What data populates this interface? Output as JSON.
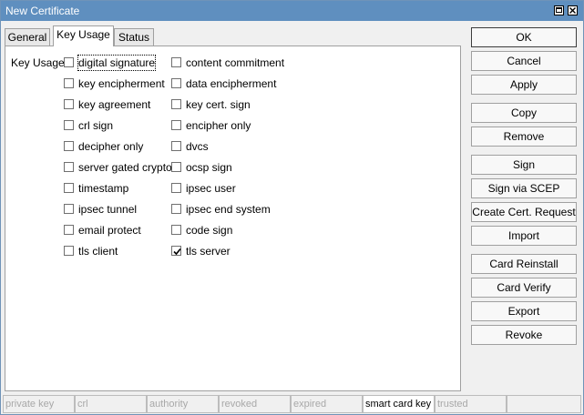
{
  "window": {
    "title": "New Certificate"
  },
  "tabs": [
    {
      "label": "General"
    },
    {
      "label": "Key Usage"
    },
    {
      "label": "Status"
    }
  ],
  "key_usage": {
    "label": "Key Usage:",
    "left_column": [
      {
        "label": "digital signature",
        "checked": false
      },
      {
        "label": "key encipherment",
        "checked": false
      },
      {
        "label": "key agreement",
        "checked": false
      },
      {
        "label": "crl sign",
        "checked": false
      },
      {
        "label": "decipher only",
        "checked": false
      },
      {
        "label": "server gated crypto",
        "checked": false
      },
      {
        "label": "timestamp",
        "checked": false
      },
      {
        "label": "ipsec tunnel",
        "checked": false
      },
      {
        "label": "email protect",
        "checked": false
      },
      {
        "label": "tls client",
        "checked": false
      }
    ],
    "right_column": [
      {
        "label": "content commitment",
        "checked": false
      },
      {
        "label": "data encipherment",
        "checked": false
      },
      {
        "label": "key cert. sign",
        "checked": false
      },
      {
        "label": "encipher only",
        "checked": false
      },
      {
        "label": "dvcs",
        "checked": false
      },
      {
        "label": "ocsp sign",
        "checked": false
      },
      {
        "label": "ipsec user",
        "checked": false
      },
      {
        "label": "ipsec end system",
        "checked": false
      },
      {
        "label": "code sign",
        "checked": false
      },
      {
        "label": "tls server",
        "checked": true
      }
    ]
  },
  "buttons": {
    "ok": "OK",
    "cancel": "Cancel",
    "apply": "Apply",
    "copy": "Copy",
    "remove": "Remove",
    "sign": "Sign",
    "sign_via_scep": "Sign via SCEP",
    "create_cert_request": "Create Cert. Request",
    "import": "Import",
    "card_reinstall": "Card Reinstall",
    "card_verify": "Card Verify",
    "export": "Export",
    "revoke": "Revoke"
  },
  "statusbar": [
    {
      "label": "private key",
      "active": false
    },
    {
      "label": "crl",
      "active": false
    },
    {
      "label": "authority",
      "active": false
    },
    {
      "label": "revoked",
      "active": false
    },
    {
      "label": "expired",
      "active": false
    },
    {
      "label": "smart card key",
      "active": false
    },
    {
      "label": "trusted",
      "active": true
    },
    {
      "label": "",
      "active": false
    }
  ]
}
